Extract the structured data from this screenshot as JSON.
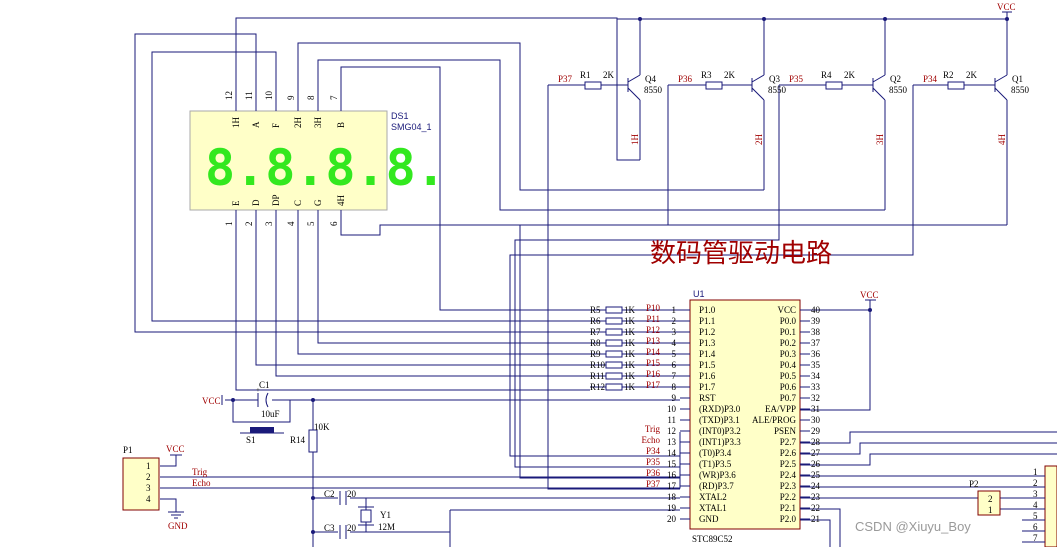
{
  "title": "数码管驱动电路",
  "watermark": "CSDN @Xiuyu_Boy",
  "display": {
    "ref": "DS1",
    "part": "SMG04_1",
    "digits": "8.8.8.8.",
    "top_pins": [
      {
        "num": "12",
        "label": "1H"
      },
      {
        "num": "11",
        "label": "A"
      },
      {
        "num": "10",
        "label": "F"
      },
      {
        "num": "9",
        "label": "2H"
      },
      {
        "num": "8",
        "label": "3H"
      },
      {
        "num": "7",
        "label": "B"
      }
    ],
    "bottom_pins": [
      {
        "num": "1",
        "label": "E"
      },
      {
        "num": "2",
        "label": "D"
      },
      {
        "num": "3",
        "label": "DP"
      },
      {
        "num": "4",
        "label": "C"
      },
      {
        "num": "5",
        "label": "G"
      },
      {
        "num": "6",
        "label": "4H"
      }
    ]
  },
  "transistors": [
    {
      "ref": "Q4",
      "part": "8550",
      "net": "P37",
      "res": "R1",
      "val": "2K",
      "out": "1H"
    },
    {
      "ref": "Q3",
      "part": "8550",
      "net": "P36",
      "res": "R3",
      "val": "2K",
      "out": "2H"
    },
    {
      "ref": "Q2",
      "part": "8550",
      "net": "P35",
      "res": "R4",
      "val": "2K",
      "out": "3H"
    },
    {
      "ref": "Q1",
      "part": "8550",
      "net": "P34",
      "res": "R2",
      "val": "2K",
      "out": "4H"
    }
  ],
  "vcc": "VCC",
  "gnd": "GND",
  "mcu": {
    "ref": "U1",
    "part": "STC89C52",
    "left_pins": [
      {
        "num": "1",
        "name": "P1.0"
      },
      {
        "num": "2",
        "name": "P1.1"
      },
      {
        "num": "3",
        "name": "P1.2"
      },
      {
        "num": "4",
        "name": "P1.3"
      },
      {
        "num": "5",
        "name": "P1.4"
      },
      {
        "num": "6",
        "name": "P1.5"
      },
      {
        "num": "7",
        "name": "P1.6"
      },
      {
        "num": "8",
        "name": "P1.7"
      },
      {
        "num": "9",
        "name": "RST"
      },
      {
        "num": "10",
        "name": "(RXD)P3.0"
      },
      {
        "num": "11",
        "name": "(TXD)P3.1"
      },
      {
        "num": "12",
        "name": "(INT0)P3.2"
      },
      {
        "num": "13",
        "name": "(INT1)P3.3"
      },
      {
        "num": "14",
        "name": "(T0)P3.4"
      },
      {
        "num": "15",
        "name": "(T1)P3.5"
      },
      {
        "num": "16",
        "name": "(WR)P3.6"
      },
      {
        "num": "17",
        "name": "(RD)P3.7"
      },
      {
        "num": "18",
        "name": "XTAL2"
      },
      {
        "num": "19",
        "name": "XTAL1"
      },
      {
        "num": "20",
        "name": "GND"
      }
    ],
    "right_pins": [
      {
        "num": "40",
        "name": "VCC"
      },
      {
        "num": "39",
        "name": "P0.0"
      },
      {
        "num": "38",
        "name": "P0.1"
      },
      {
        "num": "37",
        "name": "P0.2"
      },
      {
        "num": "36",
        "name": "P0.3"
      },
      {
        "num": "35",
        "name": "P0.4"
      },
      {
        "num": "34",
        "name": "P0.5"
      },
      {
        "num": "33",
        "name": "P0.6"
      },
      {
        "num": "32",
        "name": "P0.7"
      },
      {
        "num": "31",
        "name": "EA/VPP"
      },
      {
        "num": "30",
        "name": "ALE/PROG"
      },
      {
        "num": "29",
        "name": "PSEN"
      },
      {
        "num": "28",
        "name": "P2.7"
      },
      {
        "num": "27",
        "name": "P2.6"
      },
      {
        "num": "26",
        "name": "P2.5"
      },
      {
        "num": "25",
        "name": "P2.4"
      },
      {
        "num": "24",
        "name": "P2.3"
      },
      {
        "num": "23",
        "name": "P2.2"
      },
      {
        "num": "22",
        "name": "P2.1"
      },
      {
        "num": "21",
        "name": "P2.0"
      }
    ],
    "left_nets": [
      {
        "row": 0,
        "text": "P10"
      },
      {
        "row": 1,
        "text": "P11"
      },
      {
        "row": 2,
        "text": "P12"
      },
      {
        "row": 3,
        "text": "P13"
      },
      {
        "row": 4,
        "text": "P14"
      },
      {
        "row": 5,
        "text": "P15"
      },
      {
        "row": 6,
        "text": "P16"
      },
      {
        "row": 7,
        "text": "P17"
      },
      {
        "row": 11,
        "text": "Trig"
      },
      {
        "row": 12,
        "text": "Echo"
      },
      {
        "row": 13,
        "text": "P34"
      },
      {
        "row": 14,
        "text": "P35"
      },
      {
        "row": 15,
        "text": "P36"
      },
      {
        "row": 16,
        "text": "P37"
      }
    ]
  },
  "seg_resistors": [
    {
      "ref": "R5",
      "val": "1K"
    },
    {
      "ref": "R6",
      "val": "1K"
    },
    {
      "ref": "R7",
      "val": "1K"
    },
    {
      "ref": "R8",
      "val": "1K"
    },
    {
      "ref": "R9",
      "val": "1K"
    },
    {
      "ref": "R10",
      "val": "1K"
    },
    {
      "ref": "R11",
      "val": "1K"
    },
    {
      "ref": "R12",
      "val": "1K"
    }
  ],
  "reset": {
    "cap_ref": "C1",
    "cap_val": "10uF",
    "switch_ref": "S1",
    "res_ref": "R14",
    "res_val": "10K"
  },
  "crystal": {
    "c2": "C2",
    "c2_val": "20",
    "c3": "C3",
    "c3_val": "20",
    "xtal_ref": "Y1",
    "xtal_val": "12M"
  },
  "connector_p1": {
    "ref": "P1",
    "pins": [
      "1",
      "2",
      "3",
      "4"
    ],
    "nets": [
      "Trig",
      "Echo"
    ]
  },
  "connector_p2": {
    "ref": "P2",
    "pins": [
      "2",
      "1"
    ]
  },
  "right_header_pins": [
    "1",
    "2",
    "3",
    "4",
    "5",
    "6",
    "7"
  ]
}
